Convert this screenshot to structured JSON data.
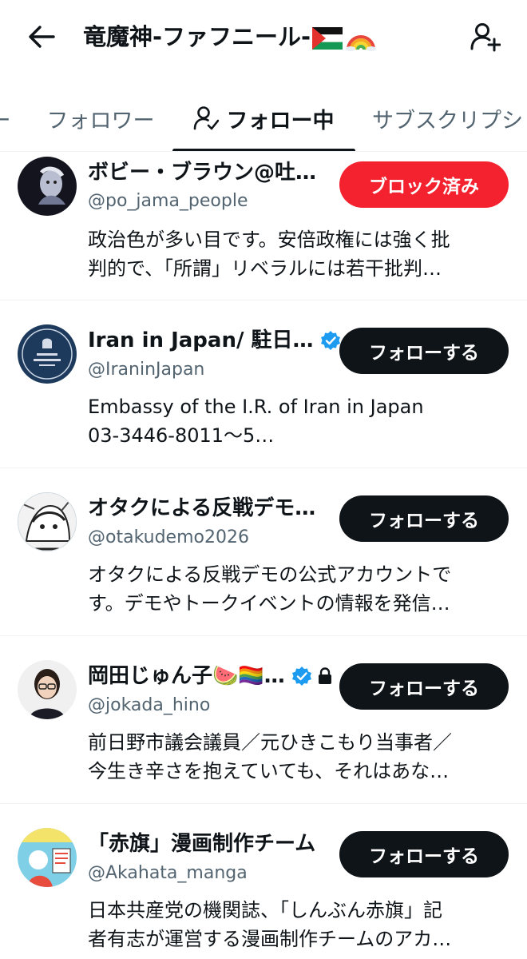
{
  "header": {
    "title": "竜魔神-ファフニール-",
    "back_icon": "arrow-left-icon",
    "add_user_icon": "person-add-icon"
  },
  "tabs": [
    {
      "label": "ー"
    },
    {
      "label": "フォロワー"
    },
    {
      "label": "フォロー中",
      "icon": "person-check-icon",
      "active": true
    },
    {
      "label": "サブスクリプシ"
    }
  ],
  "accounts": [
    {
      "name": "ボビー・ブラウン@吐…",
      "handle": "@po_jama_people",
      "bio_line1": "政治色が多い目です。安倍政権には強く批",
      "bio_line2": "判的で、「所謂」リベラルには若干批判…",
      "button": "ブロック済み"
    },
    {
      "name": "Iran in Japan/ 駐日…",
      "handle": "@IraninJapan",
      "bio_line1": "Embassy of the I.R. of Iran in Japan",
      "bio_line2": "03-3446-8011〜5…",
      "button": "フォローする"
    },
    {
      "name": "オタクによる反戦デモ…",
      "handle": "@otakudemo2026",
      "bio_line1": "オタクによる反戦デモの公式アカウントで",
      "bio_line2": "す。デモやトークイベントの情報を発信…",
      "button": "フォローする"
    },
    {
      "name": "岡田じゅん子🍉🏳️‍🌈…",
      "handle": "@jokada_hino",
      "bio_line1": "前日野市議会議員／元ひきこもり当事者／",
      "bio_line2": "今生き辛さを抱えていても、それはあな…",
      "button": "フォローする"
    },
    {
      "name": "「赤旗」漫画制作チーム",
      "handle": "@Akahata_manga",
      "bio_line1": "日本共産党の機関誌、「しんぶん赤旗」記",
      "bio_line2": "者有志が運営する漫画制作チームのアカ…",
      "button": "フォローする"
    }
  ],
  "colors": {
    "accent_blue": "#1d9bf0",
    "block_red": "#f4212e",
    "text_primary": "#0f1419",
    "text_secondary": "#536471"
  }
}
